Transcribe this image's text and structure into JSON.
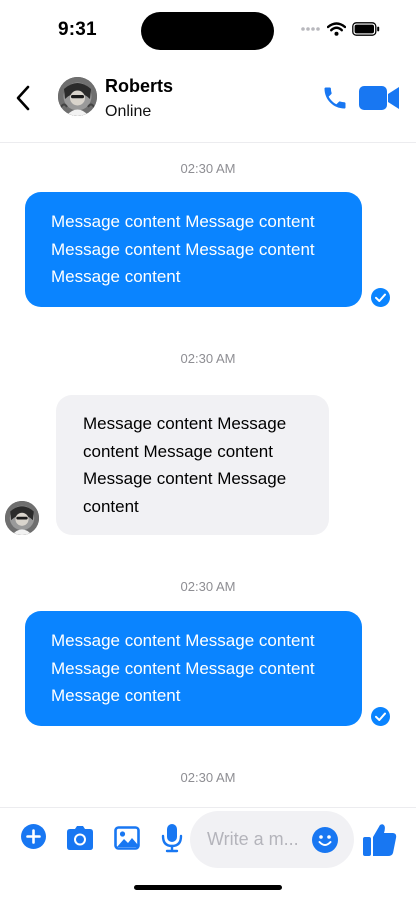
{
  "status_bar": {
    "time": "9:31"
  },
  "header": {
    "contact_name": "Roberts",
    "contact_status": "Online",
    "icons": {
      "back": "chevron-left-icon",
      "call": "phone-icon",
      "video": "video-camera-icon"
    }
  },
  "messages": [
    {
      "timestamp": "02:30 AM",
      "direction": "outgoing",
      "text": "Message content Message content Message content Message content Message content",
      "read": true
    },
    {
      "timestamp": "02:30 AM",
      "direction": "incoming",
      "text": "Message content Message content Message content Message content Message content",
      "read": false
    },
    {
      "timestamp": "02:30 AM",
      "direction": "outgoing",
      "text": "Message content Message content Message content Message content Message content",
      "read": true
    },
    {
      "timestamp": "02:30 AM"
    }
  ],
  "composer": {
    "placeholder_display": "Write a m...",
    "icons": [
      "plus-circle-icon",
      "camera-icon",
      "image-icon",
      "microphone-icon",
      "emoji-icon",
      "thumbs-up-icon"
    ]
  },
  "colors": {
    "accent": "#0A84FF",
    "incoming_bubble": "#F1F1F4",
    "timestamp": "#8E8E93"
  }
}
